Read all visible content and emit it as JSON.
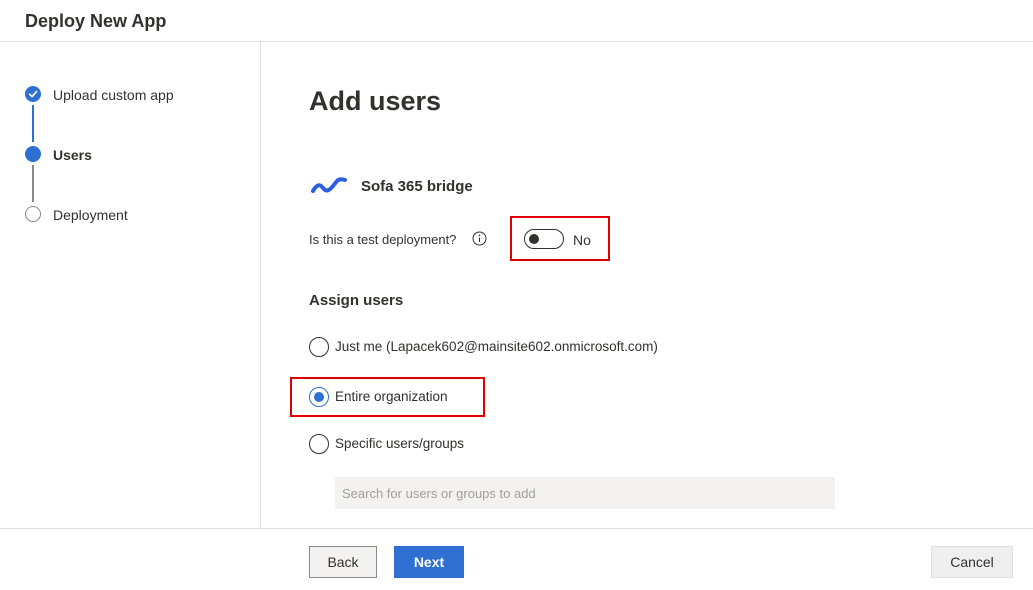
{
  "window": {
    "title": "Deploy New App"
  },
  "steps": [
    {
      "label": "Upload custom app",
      "state": "completed"
    },
    {
      "label": "Users",
      "state": "current"
    },
    {
      "label": "Deployment",
      "state": "pending"
    }
  ],
  "main": {
    "title": "Add users",
    "app_name": "Sofa 365 bridge",
    "test_deployment": {
      "label": "Is this a test deployment?",
      "toggle_value": "No",
      "enabled": false
    },
    "assign_users": {
      "title": "Assign users",
      "options": [
        {
          "label": "Just me (Lapacek602@mainsite602.onmicrosoft.com)",
          "checked": false
        },
        {
          "label": "Entire organization",
          "checked": true
        },
        {
          "label": "Specific users/groups",
          "checked": false
        }
      ],
      "search_placeholder": "Search for users or groups to add"
    }
  },
  "footer": {
    "back_label": "Back",
    "next_label": "Next",
    "cancel_label": "Cancel"
  },
  "colors": {
    "accent": "#2f6fd2",
    "highlight": "#e00000",
    "text": "#323130",
    "border": "#e1dfdd"
  },
  "icons": {
    "completed_step": "checkmark-icon",
    "info": "info-icon",
    "app_logo": "app-logo-icon"
  }
}
